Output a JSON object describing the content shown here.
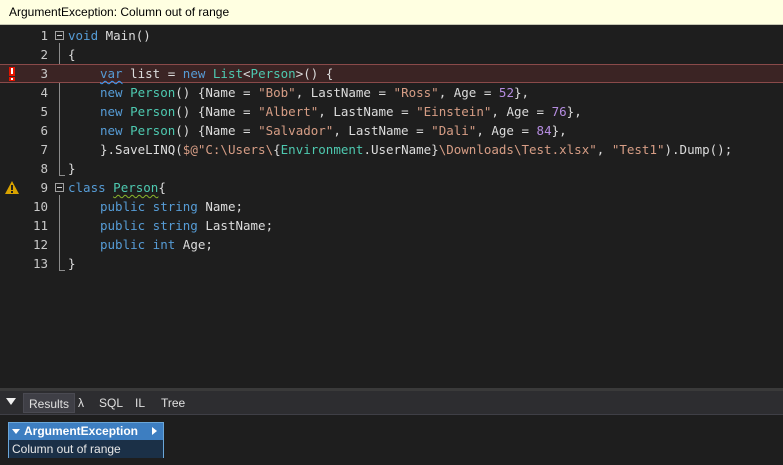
{
  "tooltip": {
    "text": "ArgumentException: Column out of range"
  },
  "editor": {
    "line_numbers": [
      "1",
      "2",
      "3",
      "4",
      "5",
      "6",
      "7",
      "8",
      "9",
      "10",
      "11",
      "12",
      "13"
    ],
    "line1": {
      "kw": "void",
      "rest": " Main()"
    },
    "line2": {
      "brace": "{"
    },
    "line3": {
      "kw_var": "var",
      "t1": " list = ",
      "kw_new": "new",
      "t2": " ",
      "ty_list": "List",
      "t3": "<",
      "ty_person": "Person",
      "t4": ">() {"
    },
    "line4": {
      "kw_new": "new",
      "ty": " Person",
      "t1": "() {Name = ",
      "s1": "\"Bob\"",
      "t2": ", LastName = ",
      "s2": "\"Ross\"",
      "t3": ", Age = ",
      "n": "52",
      "t4": "},"
    },
    "line5": {
      "kw_new": "new",
      "ty": " Person",
      "t1": "() {Name = ",
      "s1": "\"Albert\"",
      "t2": ", LastName = ",
      "s2": "\"Einstein\"",
      "t3": ", Age = ",
      "n": "76",
      "t4": "},"
    },
    "line6": {
      "kw_new": "new",
      "ty": " Person",
      "t1": "() {Name = ",
      "s1": "\"Salvador\"",
      "t2": ", LastName = ",
      "s2": "\"Dali\"",
      "t3": ", Age = ",
      "n": "84",
      "t4": "},"
    },
    "line7": {
      "t1": "}.SaveLINQ(",
      "s1": "$@\"C:\\Users\\",
      "t2": "{",
      "ty1": "Environment",
      "t3": ".UserName}",
      "s2": "\\Downloads\\Test.xlsx\"",
      "t4": ", ",
      "s3": "\"Test1\"",
      "t5": ").Dump();"
    },
    "line8": {
      "brace": "}"
    },
    "line9": {
      "kw": "class",
      "t1": " ",
      "ty": "Person",
      "t2": "{"
    },
    "line10": {
      "kw1": "public",
      "kw2": " string",
      "t1": " Name;"
    },
    "line11": {
      "kw1": "public",
      "kw2": " string",
      "t1": " LastName;"
    },
    "line12": {
      "kw1": "public",
      "kw2": " int",
      "t1": " Age;"
    },
    "line13": {
      "brace": "}"
    },
    "error_icon": "error-exclamation-icon",
    "warning_icon": "warning-triangle-icon"
  },
  "tabs": [
    {
      "label": "Results"
    },
    {
      "label": "λ"
    },
    {
      "label": "SQL"
    },
    {
      "label": "IL"
    },
    {
      "label": "Tree"
    }
  ],
  "result": {
    "exception_type": "ArgumentException",
    "message": "Column out of range"
  },
  "colors": {
    "keyword": "#569cd6",
    "type": "#4ec9b0",
    "string": "#d69d85",
    "number": "#b58ce0",
    "error_row": "#3b2424",
    "exception_header": "#3d7ec1"
  }
}
